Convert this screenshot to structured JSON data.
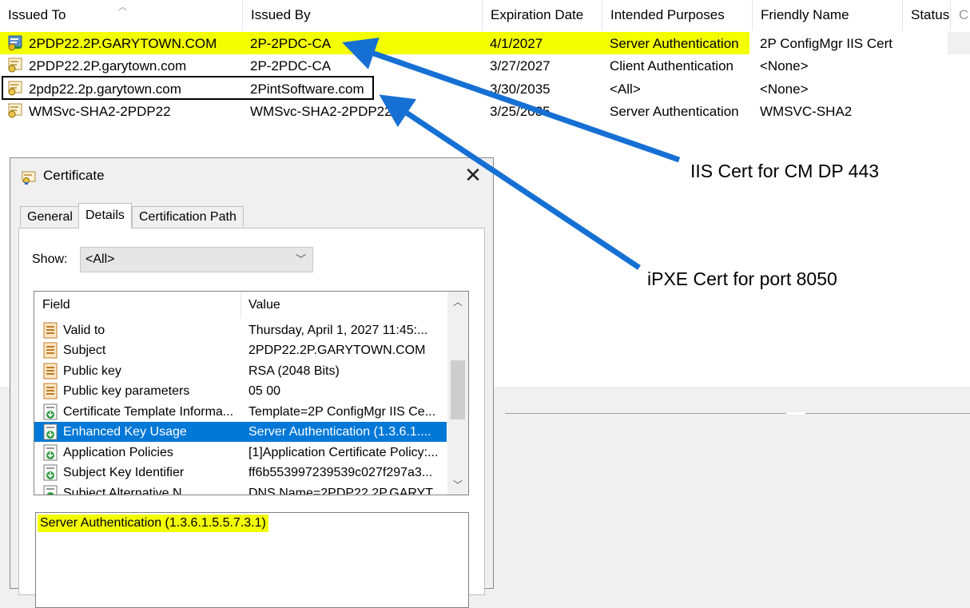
{
  "columns": [
    "Issued To",
    "Issued By",
    "Expiration Date",
    "Intended Purposes",
    "Friendly Name",
    "Status",
    "C"
  ],
  "rows": [
    {
      "issued_to": "2PDP22.2P.GARYTOWN.COM",
      "issued_by": "2P-2PDC-CA",
      "expiration": "4/1/2027",
      "purposes": "Server Authentication",
      "friendly": "2P ConfigMgr IIS Cert",
      "highlighted": true
    },
    {
      "issued_to": "2PDP22.2P.garytown.com",
      "issued_by": "2P-2PDC-CA",
      "expiration": "3/27/2027",
      "purposes": "Client Authentication",
      "friendly": "<None>"
    },
    {
      "issued_to": "2pdp22.2p.garytown.com",
      "issued_by": "2PintSoftware.com",
      "expiration": "3/30/2035",
      "purposes": "<All>",
      "friendly": "<None>",
      "boxed": true
    },
    {
      "issued_to": "WMSvc-SHA2-2PDP22",
      "issued_by": "WMSvc-SHA2-2PDP22",
      "expiration": "3/25/2035",
      "purposes": "Server Authentication",
      "friendly": "WMSVC-SHA2"
    }
  ],
  "dialog": {
    "title": "Certificate",
    "close_glyph": "✕",
    "tabs": [
      "General",
      "Details",
      "Certification Path"
    ],
    "active_tab": "Details",
    "show_label": "Show:",
    "show_value": "<All>",
    "list_headers": {
      "field": "Field",
      "value": "Value"
    },
    "fields": [
      {
        "field": "Valid to",
        "value": "Thursday, April 1, 2027 11:45:...",
        "icon": "property-icon"
      },
      {
        "field": "Subject",
        "value": "2PDP22.2P.GARYTOWN.COM",
        "icon": "property-icon"
      },
      {
        "field": "Public key",
        "value": "RSA (2048 Bits)",
        "icon": "property-icon"
      },
      {
        "field": "Public key parameters",
        "value": "05 00",
        "icon": "property-icon"
      },
      {
        "field": "Certificate Template Informa...",
        "value": "Template=2P ConfigMgr IIS Ce...",
        "icon": "extension-icon"
      },
      {
        "field": "Enhanced Key Usage",
        "value": "Server Authentication (1.3.6.1....",
        "icon": "extension-icon",
        "selected": true
      },
      {
        "field": "Application Policies",
        "value": "[1]Application Certificate Policy:...",
        "icon": "extension-icon"
      },
      {
        "field": "Subject Key Identifier",
        "value": "ff6b553997239539c027f297a3...",
        "icon": "extension-icon"
      },
      {
        "field": "Subject Alternative N...",
        "value": "DNS Name=2PDP22.2P.GARYT...",
        "icon": "extension-icon"
      }
    ],
    "detail_value": "Server Authentication (1.3.6.1.5.5.7.3.1)"
  },
  "annotations": {
    "iis": "IIS Cert for CM DP 443",
    "ipxe": "iPXE Cert for port 8050"
  },
  "colors": {
    "highlight": "#f3ff00",
    "arrow": "#1670d4",
    "selection": "#0078d7"
  }
}
